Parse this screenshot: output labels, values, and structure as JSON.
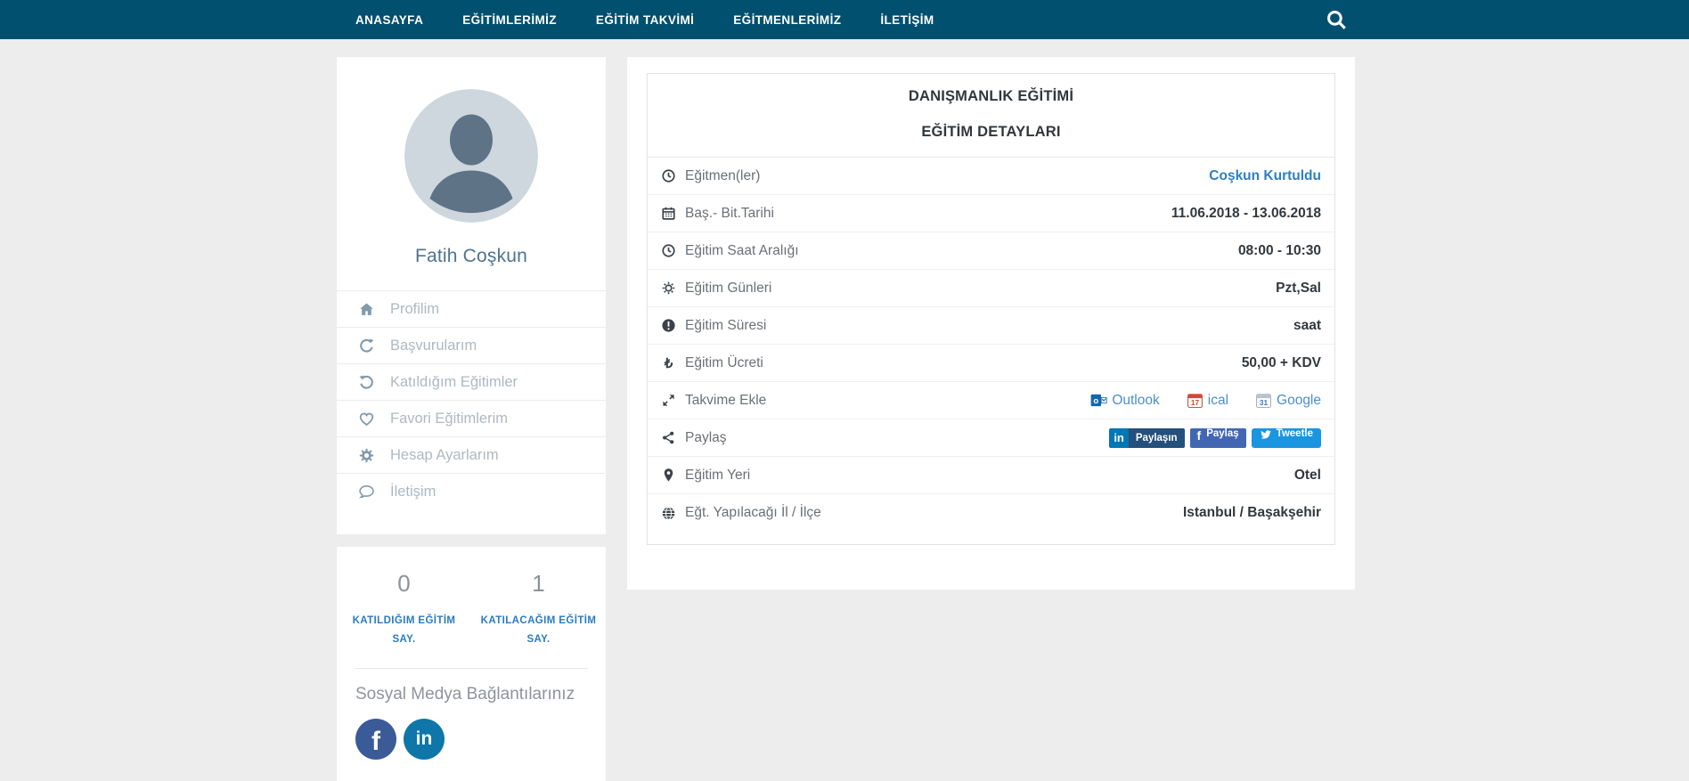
{
  "navbar": {
    "items": [
      {
        "label": "ANASAYFA"
      },
      {
        "label": "EĞİTİMLERİMİZ"
      },
      {
        "label": "EĞİTİM TAKVİMİ"
      },
      {
        "label": "EĞİTMENLERİMİZ"
      },
      {
        "label": "İLETİŞİM"
      }
    ]
  },
  "sidebar": {
    "profile": {
      "name": "Fatih Coşkun"
    },
    "menu": [
      {
        "icon": "home-icon",
        "label": "Profilim"
      },
      {
        "icon": "refresh-icon",
        "label": "Başvurularım"
      },
      {
        "icon": "history-icon",
        "label": "Katıldığım Eğitimler"
      },
      {
        "icon": "heart-icon",
        "label": "Favori Eğitimlerim"
      },
      {
        "icon": "gear-icon",
        "label": "Hesap Ayarlarım"
      },
      {
        "icon": "comment-icon",
        "label": "İletişim"
      }
    ],
    "stats": [
      {
        "value": "0",
        "label": "KATILDIĞIM EĞİTİM SAY."
      },
      {
        "value": "1",
        "label": "KATILACAĞIM EĞİTİM SAY."
      }
    ],
    "social": {
      "heading": "Sosyal Medya Bağlantılarınız"
    }
  },
  "main": {
    "title": "DANIŞMANLIK EĞİTİMİ",
    "subtitle": "EĞİTİM DETAYLARI",
    "rows": [
      {
        "icon": "clock-icon",
        "label": "Eğitmen(ler)",
        "value": "Coşkun Kurtuldu"
      },
      {
        "icon": "calendar-icon",
        "label": "Baş.- Bit.Tarihi",
        "value": "11.06.2018 - 13.06.2018"
      },
      {
        "icon": "clock-icon",
        "label": "Eğitim Saat Aralığı",
        "value": "08:00 - 10:30"
      },
      {
        "icon": "sun-icon",
        "label": "Eğitim Günleri",
        "value": "Pzt,Sal"
      },
      {
        "icon": "exclamation-circle-icon",
        "label": "Eğitim Süresi",
        "value": "saat"
      },
      {
        "icon": "lira-icon",
        "label": "Eğitim Ücreti",
        "value": "50,00 + KDV"
      },
      {
        "icon": "expand-arrows-icon",
        "label": "Takvime Ekle"
      },
      {
        "icon": "share-icon",
        "label": "Paylaş"
      },
      {
        "icon": "map-marker-icon",
        "label": "Eğitim Yeri",
        "value": "Otel"
      },
      {
        "icon": "globe-icon",
        "label": "Eğt. Yapılacağı İl / İlçe",
        "value": "Istanbul / Başakşehir"
      }
    ],
    "calendar": {
      "outlook": "Outlook",
      "ical": "ical",
      "google": "Google"
    },
    "share": {
      "linkedin": "Paylaşın",
      "facebook": "Paylaş",
      "twitter": "Tweetle"
    }
  },
  "glyphs": {
    "lira": "₺",
    "facebook": "f",
    "linkedin": "in"
  },
  "colors": {
    "navbar": "#02506f",
    "link": "#2d7fc1",
    "facebook": "#3a5a98",
    "linkedin": "#0e76a8",
    "linkedin_share": "#0077b5",
    "twitter": "#1b95e0",
    "background": "#ededed"
  }
}
